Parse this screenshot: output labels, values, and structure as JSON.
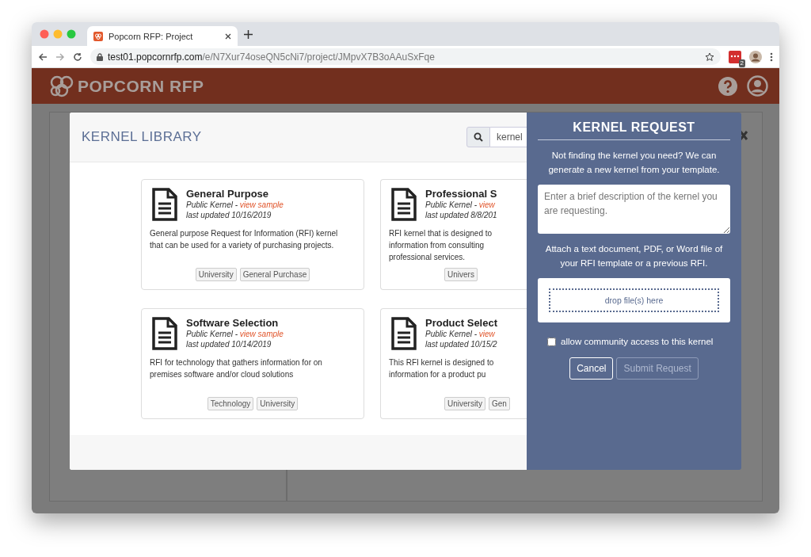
{
  "browser": {
    "tab_title": "Popcorn RFP: Project",
    "url_host": "test01.popcornrfp.com",
    "url_path": "/e/N7Xur74oseQN5cNi7/project/JMpvX7B3oAAuSxFqe",
    "extension_badge": "2"
  },
  "app_header": {
    "logo": "POPCORN RFP"
  },
  "library": {
    "title": "KERNEL LIBRARY",
    "search_value": "kernel",
    "kernels": [
      {
        "name": "General Purpose",
        "visibility": "Public Kernel -",
        "sample_link": "view sample",
        "updated": "last updated 10/16/2019",
        "description_lines": [
          "General purpose Request for Information (RFI) kernel",
          "that can be used for a variety of purchasing projects."
        ],
        "tags": [
          "University",
          "General Purchase"
        ]
      },
      {
        "name": "Professional S",
        "visibility": "Public Kernel -",
        "sample_link": "view",
        "updated": "last updated 8/8/201",
        "description_lines": [
          "RFI kernel that is designed to",
          "information from consulting",
          "professional services."
        ],
        "tags": [
          "Univers"
        ]
      },
      {
        "name": "Software Selection",
        "visibility": "Public Kernel -",
        "sample_link": "view sample",
        "updated": "last updated 10/14/2019",
        "description_lines": [
          "RFI for technology that gathers information for on",
          "premises software and/or cloud solutions"
        ],
        "tags": [
          "Technology",
          "University"
        ]
      },
      {
        "name": "Product Select",
        "visibility": "Public Kernel -",
        "sample_link": "view",
        "updated": "last updated 10/15/2",
        "description_lines": [
          "This RFI kernel is designed to",
          "information for a product pu"
        ],
        "tags": [
          "University",
          "Gen"
        ]
      }
    ]
  },
  "request": {
    "title": "KERNEL REQUEST",
    "intro": "Not finding the kernel you need? We can generate a new kernel from your template.",
    "description_placeholder": "Enter a brief description of the kernel you are requesting.",
    "attach_text": "Attach a text document, PDF, or Word file of your RFI template or a previous RFI.",
    "dropzone": "drop file(s) here",
    "checkbox": {
      "label": "allow community access to this kernel",
      "checked": false
    },
    "buttons": [
      {
        "label": "Cancel",
        "disabled": false
      },
      {
        "label": "Submit Request",
        "disabled": true
      }
    ]
  }
}
